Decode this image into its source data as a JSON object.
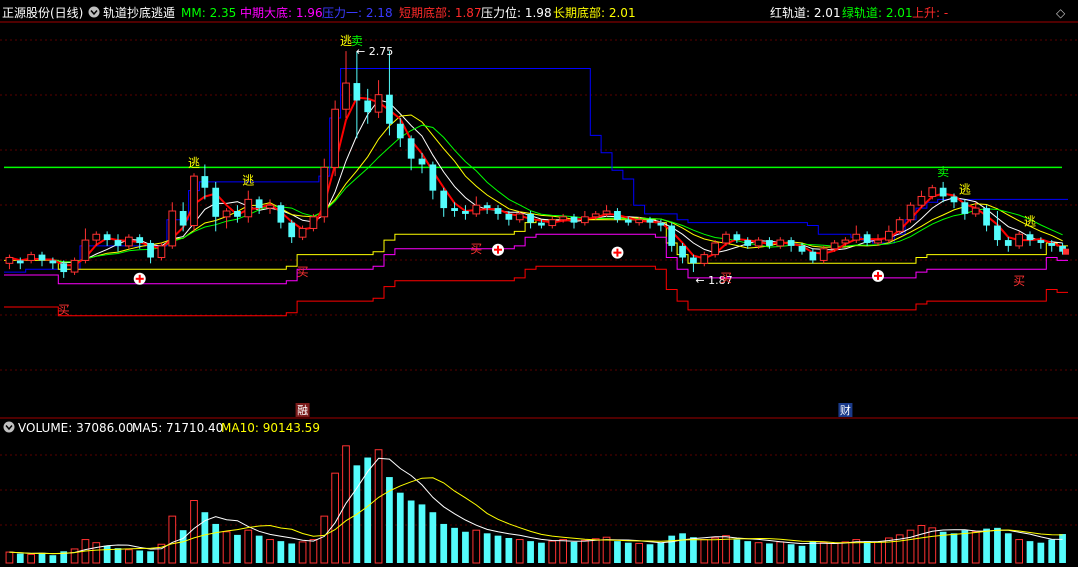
{
  "header": {
    "stock": "正源股份(日线)",
    "indicator_name": "轨道抄底逃遁",
    "mm": "MM: 2.35",
    "mid_bottom": "中期大底: 1.96",
    "pressure1": "压力一: 2.18",
    "short_bottom": "短期底部: 1.87",
    "pressure": "压力位: 1.98",
    "long_bottom": "长期底部: 2.01",
    "red_track": "红轨道: 2.01",
    "green_track": "绿轨道: 2.01",
    "rising": "上升: -"
  },
  "volume_header": {
    "label": "VOLUME: 37086.00",
    "ma5": "MA5: 71710.40",
    "ma10": "MA10: 90143.59"
  },
  "colors": {
    "up": "#ff3232",
    "down": "#54fcfc",
    "mm": "#00ff00",
    "mid_bottom": "#ff00ff",
    "pressure1": "#0000ff",
    "short_bottom": "#ff0000",
    "pressure": "#ffffff",
    "long_bottom": "#ffff00",
    "red_track": "#ffffff",
    "green_track": "#00ff00",
    "rising": "#ff0000",
    "text_default": "#ffffff"
  },
  "icons": [
    "collapse-circle-icon",
    "diamond-icon"
  ],
  "chart_data": {
    "type": "candlestick",
    "price_range": [
      1.55,
      2.85
    ],
    "price_label_high": "2.75",
    "price_label_low": "1.87",
    "mm_level": 2.35,
    "candles": [
      [
        2.02,
        2.04,
        2.0,
        2.05
      ],
      [
        2.03,
        2.02,
        2.0,
        2.04
      ],
      [
        2.03,
        2.05,
        2.02,
        2.06
      ],
      [
        2.05,
        2.03,
        2.01,
        2.06
      ],
      [
        2.03,
        2.02,
        2.0,
        2.04
      ],
      [
        2.02,
        1.99,
        1.97,
        2.03
      ],
      [
        1.99,
        2.03,
        1.98,
        2.04
      ],
      [
        2.03,
        2.1,
        2.02,
        2.14
      ],
      [
        2.1,
        2.12,
        2.08,
        2.13
      ],
      [
        2.12,
        2.1,
        2.08,
        2.13
      ],
      [
        2.1,
        2.08,
        2.06,
        2.12
      ],
      [
        2.08,
        2.11,
        2.07,
        2.12
      ],
      [
        2.11,
        2.09,
        2.07,
        2.12
      ],
      [
        2.09,
        2.04,
        2.02,
        2.1
      ],
      [
        2.04,
        2.08,
        2.03,
        2.09
      ],
      [
        2.08,
        2.2,
        2.07,
        2.23
      ],
      [
        2.2,
        2.15,
        2.13,
        2.23
      ],
      [
        2.15,
        2.32,
        2.13,
        2.33
      ],
      [
        2.32,
        2.28,
        2.24,
        2.36
      ],
      [
        2.28,
        2.18,
        2.13,
        2.3
      ],
      [
        2.18,
        2.2,
        2.14,
        2.21
      ],
      [
        2.2,
        2.18,
        2.16,
        2.22
      ],
      [
        2.18,
        2.24,
        2.16,
        2.27
      ],
      [
        2.24,
        2.21,
        2.19,
        2.25
      ],
      [
        2.21,
        2.22,
        2.19,
        2.24
      ],
      [
        2.22,
        2.16,
        2.14,
        2.23
      ],
      [
        2.16,
        2.11,
        2.09,
        2.17
      ],
      [
        2.11,
        2.14,
        2.1,
        2.15
      ],
      [
        2.14,
        2.18,
        2.13,
        2.19
      ],
      [
        2.18,
        2.35,
        2.16,
        2.38
      ],
      [
        2.35,
        2.55,
        2.32,
        2.58
      ],
      [
        2.55,
        2.64,
        2.52,
        2.75
      ],
      [
        2.64,
        2.58,
        2.45,
        2.75
      ],
      [
        2.58,
        2.54,
        2.5,
        2.62
      ],
      [
        2.54,
        2.6,
        2.52,
        2.65
      ],
      [
        2.6,
        2.5,
        2.46,
        2.75
      ],
      [
        2.5,
        2.45,
        2.42,
        2.52
      ],
      [
        2.45,
        2.38,
        2.34,
        2.46
      ],
      [
        2.38,
        2.36,
        2.33,
        2.4
      ],
      [
        2.36,
        2.27,
        2.24,
        2.37
      ],
      [
        2.27,
        2.21,
        2.18,
        2.28
      ],
      [
        2.21,
        2.2,
        2.18,
        2.23
      ],
      [
        2.2,
        2.19,
        2.17,
        2.22
      ],
      [
        2.19,
        2.22,
        2.18,
        2.25
      ],
      [
        2.22,
        2.21,
        2.19,
        2.23
      ],
      [
        2.21,
        2.19,
        2.17,
        2.22
      ],
      [
        2.19,
        2.17,
        2.15,
        2.2
      ],
      [
        2.17,
        2.19,
        2.16,
        2.2
      ],
      [
        2.19,
        2.16,
        2.14,
        2.2
      ],
      [
        2.16,
        2.15,
        2.14,
        2.17
      ],
      [
        2.15,
        2.17,
        2.14,
        2.18
      ],
      [
        2.17,
        2.18,
        2.16,
        2.19
      ],
      [
        2.18,
        2.16,
        2.14,
        2.19
      ],
      [
        2.16,
        2.18,
        2.15,
        2.2
      ],
      [
        2.18,
        2.19,
        2.17,
        2.2
      ],
      [
        2.19,
        2.2,
        2.18,
        2.22
      ],
      [
        2.2,
        2.17,
        2.16,
        2.21
      ],
      [
        2.17,
        2.16,
        2.15,
        2.18
      ],
      [
        2.16,
        2.17,
        2.15,
        2.18
      ],
      [
        2.17,
        2.16,
        2.14,
        2.18
      ],
      [
        2.16,
        2.15,
        2.13,
        2.17
      ],
      [
        2.15,
        2.08,
        2.06,
        2.16
      ],
      [
        2.08,
        2.04,
        2.02,
        2.09
      ],
      [
        2.04,
        2.02,
        1.99,
        2.05
      ],
      [
        2.02,
        2.05,
        2.01,
        2.06
      ],
      [
        2.05,
        2.09,
        2.04,
        2.1
      ],
      [
        2.09,
        2.12,
        2.08,
        2.13
      ],
      [
        2.12,
        2.1,
        2.09,
        2.13
      ],
      [
        2.1,
        2.08,
        2.07,
        2.11
      ],
      [
        2.08,
        2.1,
        2.07,
        2.11
      ],
      [
        2.1,
        2.08,
        2.07,
        2.11
      ],
      [
        2.08,
        2.1,
        2.07,
        2.11
      ],
      [
        2.1,
        2.08,
        2.06,
        2.11
      ],
      [
        2.08,
        2.06,
        2.05,
        2.09
      ],
      [
        2.06,
        2.03,
        2.02,
        2.07
      ],
      [
        2.03,
        2.07,
        2.02,
        2.08
      ],
      [
        2.07,
        2.09,
        2.06,
        2.1
      ],
      [
        2.09,
        2.1,
        2.08,
        2.11
      ],
      [
        2.1,
        2.12,
        2.09,
        2.15
      ],
      [
        2.12,
        2.09,
        2.08,
        2.13
      ],
      [
        2.09,
        2.1,
        2.08,
        2.12
      ],
      [
        2.1,
        2.13,
        2.09,
        2.15
      ],
      [
        2.13,
        2.17,
        2.12,
        2.18
      ],
      [
        2.17,
        2.22,
        2.16,
        2.23
      ],
      [
        2.22,
        2.25,
        2.21,
        2.27
      ],
      [
        2.25,
        2.28,
        2.24,
        2.29
      ],
      [
        2.28,
        2.25,
        2.23,
        2.3
      ],
      [
        2.25,
        2.23,
        2.21,
        2.26
      ],
      [
        2.23,
        2.19,
        2.17,
        2.24
      ],
      [
        2.19,
        2.21,
        2.18,
        2.23
      ],
      [
        2.21,
        2.15,
        2.13,
        2.22
      ],
      [
        2.15,
        2.1,
        2.08,
        2.2
      ],
      [
        2.1,
        2.08,
        2.06,
        2.11
      ],
      [
        2.08,
        2.12,
        2.07,
        2.13
      ],
      [
        2.12,
        2.1,
        2.08,
        2.13
      ],
      [
        2.1,
        2.09,
        2.07,
        2.11
      ],
      [
        2.09,
        2.08,
        2.06,
        2.1
      ],
      [
        2.08,
        2.06,
        2.05,
        2.09
      ]
    ],
    "volumes": [
      14000,
      12000,
      11000,
      13000,
      10000,
      15000,
      18000,
      30000,
      26000,
      22000,
      19000,
      17000,
      16000,
      15000,
      24000,
      60000,
      42000,
      80000,
      65000,
      50000,
      40000,
      36000,
      42000,
      35000,
      30000,
      28000,
      25000,
      27000,
      30000,
      60000,
      115000,
      150000,
      125000,
      135000,
      145000,
      110000,
      90000,
      80000,
      75000,
      65000,
      50000,
      45000,
      40000,
      42000,
      38000,
      35000,
      32000,
      30000,
      28000,
      26000,
      28000,
      30000,
      27000,
      29000,
      31000,
      33000,
      28000,
      26000,
      25000,
      24000,
      26000,
      35000,
      38000,
      33000,
      30000,
      32000,
      35000,
      30000,
      28000,
      26000,
      25000,
      27000,
      24000,
      22000,
      28000,
      26000,
      25000,
      27000,
      30000,
      28000,
      27000,
      32000,
      36000,
      42000,
      48000,
      45000,
      40000,
      38000,
      42000,
      40000,
      44000,
      45000,
      38000,
      30000,
      28000,
      26000,
      30000,
      37086
    ],
    "volume_range": [
      0,
      160000
    ]
  },
  "annotations": {
    "escape": "逃",
    "sell": "卖",
    "buy": "买",
    "event1": "融",
    "event2": "财"
  }
}
